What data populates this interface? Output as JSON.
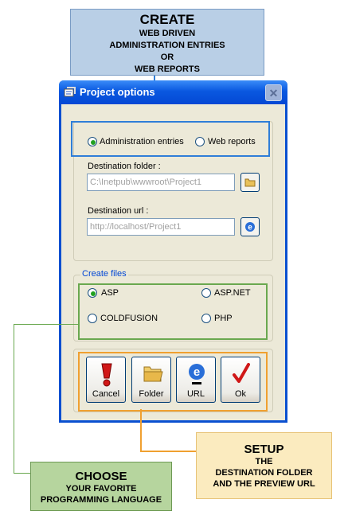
{
  "callouts": {
    "create": {
      "title": "CREATE",
      "lines": [
        "WEB DRIVEN",
        "ADMINISTRATION ENTRIES",
        "OR",
        "WEB REPORTS"
      ]
    },
    "setup": {
      "title": "SETUP",
      "lines": [
        "THE",
        "DESTINATION FOLDER",
        "AND THE PREVIEW URL"
      ]
    },
    "choose": {
      "title": "CHOOSE",
      "lines": [
        "YOUR FAVORITE",
        "PROGRAMMING LANGUAGE"
      ]
    }
  },
  "window": {
    "title": "Project options",
    "close_label": "✕"
  },
  "mode": {
    "options": [
      {
        "label": "Administration entries",
        "selected": true
      },
      {
        "label": "Web reports",
        "selected": false
      }
    ]
  },
  "destination_folder": {
    "label": "Destination folder :",
    "value": "C:\\Inetpub\\wwwroot\\Project1"
  },
  "destination_url": {
    "label": "Destination url :",
    "value": "http://localhost/Project1"
  },
  "create_files": {
    "label": "Create files",
    "options": [
      {
        "label": "ASP",
        "selected": true
      },
      {
        "label": "ASP.NET",
        "selected": false
      },
      {
        "label": "COLDFUSION",
        "selected": false
      },
      {
        "label": "PHP",
        "selected": false
      }
    ]
  },
  "buttons": [
    {
      "label": "Cancel",
      "icon": "exclamation-icon"
    },
    {
      "label": "Folder",
      "icon": "folder-icon"
    },
    {
      "label": "URL",
      "icon": "ie-icon"
    },
    {
      "label": "Ok",
      "icon": "checkmark-icon"
    }
  ],
  "colors": {
    "create": "#b9cfe6",
    "setup": "#fbebbf",
    "choose": "#b6d59e",
    "titlebar": "#0a58e0"
  }
}
